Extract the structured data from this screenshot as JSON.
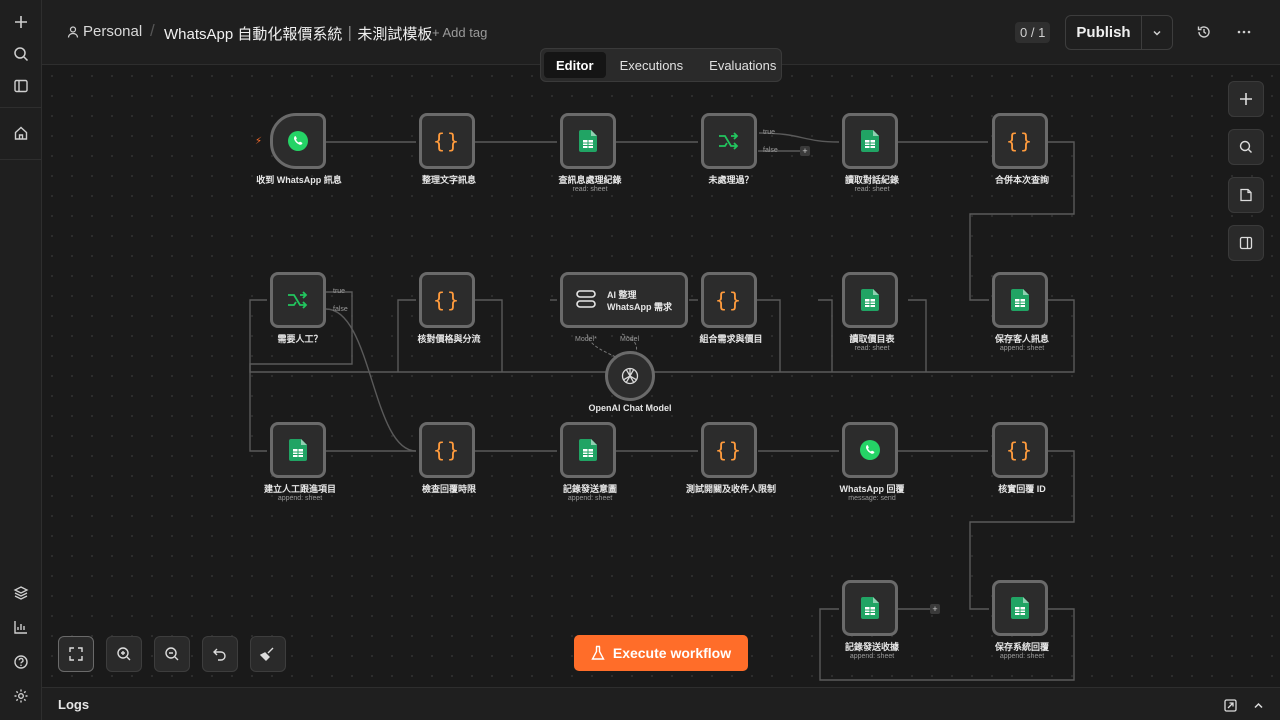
{
  "breadcrumb": {
    "owner": "Personal",
    "title": "WhatsApp 自動化報價系統｜未測試模板",
    "add_tag": "+ Add tag"
  },
  "header": {
    "counter": "0 / 1",
    "publish_label": "Publish"
  },
  "tabs": [
    {
      "label": "Editor",
      "active": true
    },
    {
      "label": "Executions",
      "active": false
    },
    {
      "label": "Evaluations",
      "active": false
    }
  ],
  "nodes": {
    "n1": {
      "label": "收到 WhatsApp 訊息",
      "sub": ""
    },
    "n2": {
      "label": "整理文字訊息",
      "sub": ""
    },
    "n3": {
      "label": "查訊息處理紀錄",
      "sub": "read: sheet"
    },
    "n4": {
      "label": "未處理過？",
      "sub": ""
    },
    "n5": {
      "label": "讀取對話紀錄",
      "sub": "read: sheet"
    },
    "n6": {
      "label": "合併本次查詢",
      "sub": ""
    },
    "n7": {
      "label": "需要人工？",
      "sub": ""
    },
    "n8": {
      "label": "核對價格與分流",
      "sub": ""
    },
    "n9": {
      "label": "AI 整理\nWhatsApp 需求",
      "sub": ""
    },
    "n10": {
      "label": "組合需求與價目",
      "sub": ""
    },
    "n11": {
      "label": "讀取價目表",
      "sub": "read: sheet"
    },
    "n12": {
      "label": "保存客人訊息",
      "sub": "append: sheet"
    },
    "n13": {
      "label": "OpenAI Chat Model",
      "sub": ""
    },
    "n14": {
      "label": "建立人工跟進項目",
      "sub": "append: sheet"
    },
    "n15": {
      "label": "檢查回覆時限",
      "sub": ""
    },
    "n16": {
      "label": "記錄發送意圖",
      "sub": "append: sheet"
    },
    "n17": {
      "label": "測試開關及收件人限制",
      "sub": ""
    },
    "n18": {
      "label": "WhatsApp 回覆",
      "sub": "message: send"
    },
    "n19": {
      "label": "核實回覆 ID",
      "sub": ""
    },
    "n20": {
      "label": "記錄發送收據",
      "sub": "append: sheet"
    },
    "n21": {
      "label": "保存系統回覆",
      "sub": "append: sheet"
    }
  },
  "branch_labels": {
    "true": "true",
    "false": "false",
    "model_star": "Model*",
    "model": "Model"
  },
  "execute_label": "Execute workflow",
  "logs_label": "Logs",
  "colors": {
    "accent": "#ff6d29",
    "node_border": "#6a6a6a",
    "sheets_green": "#21a464",
    "whatsapp_green": "#25d366",
    "code_orange": "#ff9b3d"
  }
}
